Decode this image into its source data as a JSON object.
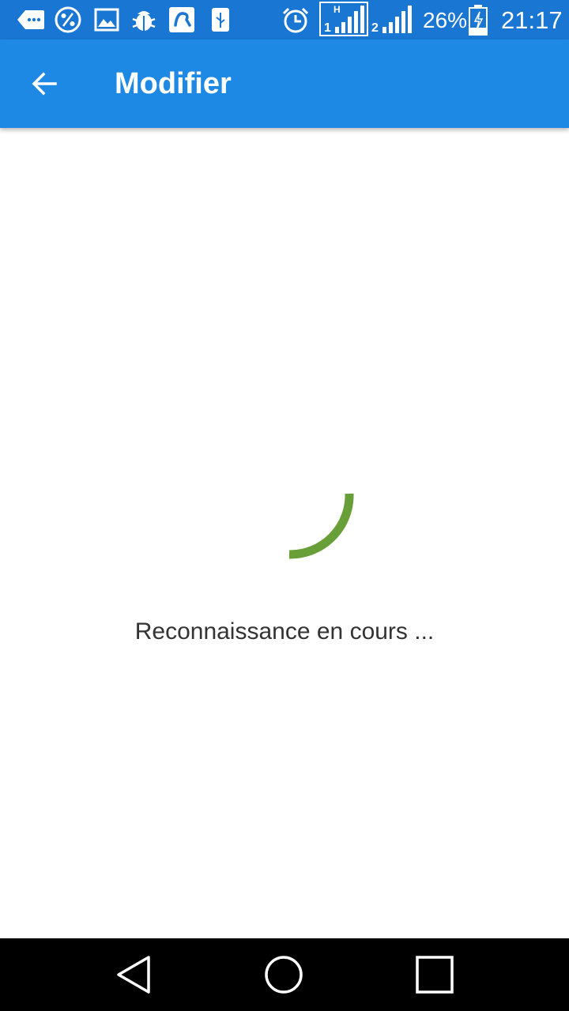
{
  "status_bar": {
    "battery": "26%",
    "time": "21:17",
    "network_type": "H",
    "sim1_label": "1",
    "sim2_label": "2",
    "icons": [
      "message-icon",
      "percent-icon",
      "image-icon",
      "bug-icon",
      "app-icon",
      "usb-icon",
      "alarm-icon",
      "signal-sim1-icon",
      "signal-sim2-icon",
      "battery-charging-icon"
    ]
  },
  "app_bar": {
    "title": "Modifier",
    "back_icon": "arrow-back-icon",
    "color": "#1e88e5"
  },
  "loading": {
    "message": "Reconnaissance en cours ...",
    "spinner_color": "#689f38"
  },
  "nav_bar": {
    "icons": [
      "back-triangle-icon",
      "home-circle-icon",
      "recents-square-icon"
    ]
  }
}
